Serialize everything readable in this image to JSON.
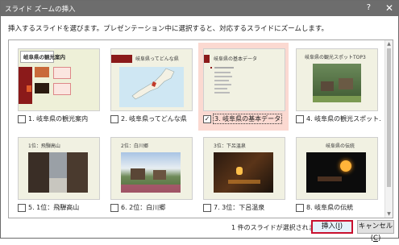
{
  "window": {
    "title": "スライド ズームの挿入",
    "help_glyph": "?",
    "close_glyph": "✕"
  },
  "instruction": "挿入するスライドを選びます。プレゼンテーション中に選択すると、対応するスライドにズームします。",
  "slides": [
    {
      "caption": "1. 岐阜県の観光案内",
      "checked": false,
      "thumb_title": "岐阜県の観光案内"
    },
    {
      "caption": "2. 岐阜県ってどんな県",
      "checked": false,
      "thumb_title": "岐阜県ってどんな県"
    },
    {
      "caption": "3. 岐阜県の基本データ",
      "checked": true,
      "thumb_title": "岐阜県の基本データ"
    },
    {
      "caption": "4. 岐阜県の観光スポット...",
      "checked": false,
      "thumb_title": "岐阜県の観光スポットTOP3"
    },
    {
      "caption": "5. 1位：飛騨高山",
      "checked": false,
      "thumb_title": "1位：飛騨高山"
    },
    {
      "caption": "6. 2位：白川郷",
      "checked": false,
      "thumb_title": "2位：白川郷"
    },
    {
      "caption": "7. 3位：下呂温泉",
      "checked": false,
      "thumb_title": "3位：下呂温泉"
    },
    {
      "caption": "8. 岐阜県の伝統",
      "checked": false,
      "thumb_title": "岐阜県の伝統"
    }
  ],
  "checkmark": "✓",
  "status": "1 件のスライドが選択されました",
  "buttons": {
    "insert": {
      "label": "挿入(",
      "key": "I",
      "tail": ")"
    },
    "cancel": {
      "label": "キャンセル(",
      "key": "C",
      "tail": ")"
    }
  },
  "colors": {
    "titlebar": "#6d6d6d",
    "selection": "#fbd9d1",
    "accent_red": "#8b1a1a",
    "insert_border": "#c8102e"
  }
}
